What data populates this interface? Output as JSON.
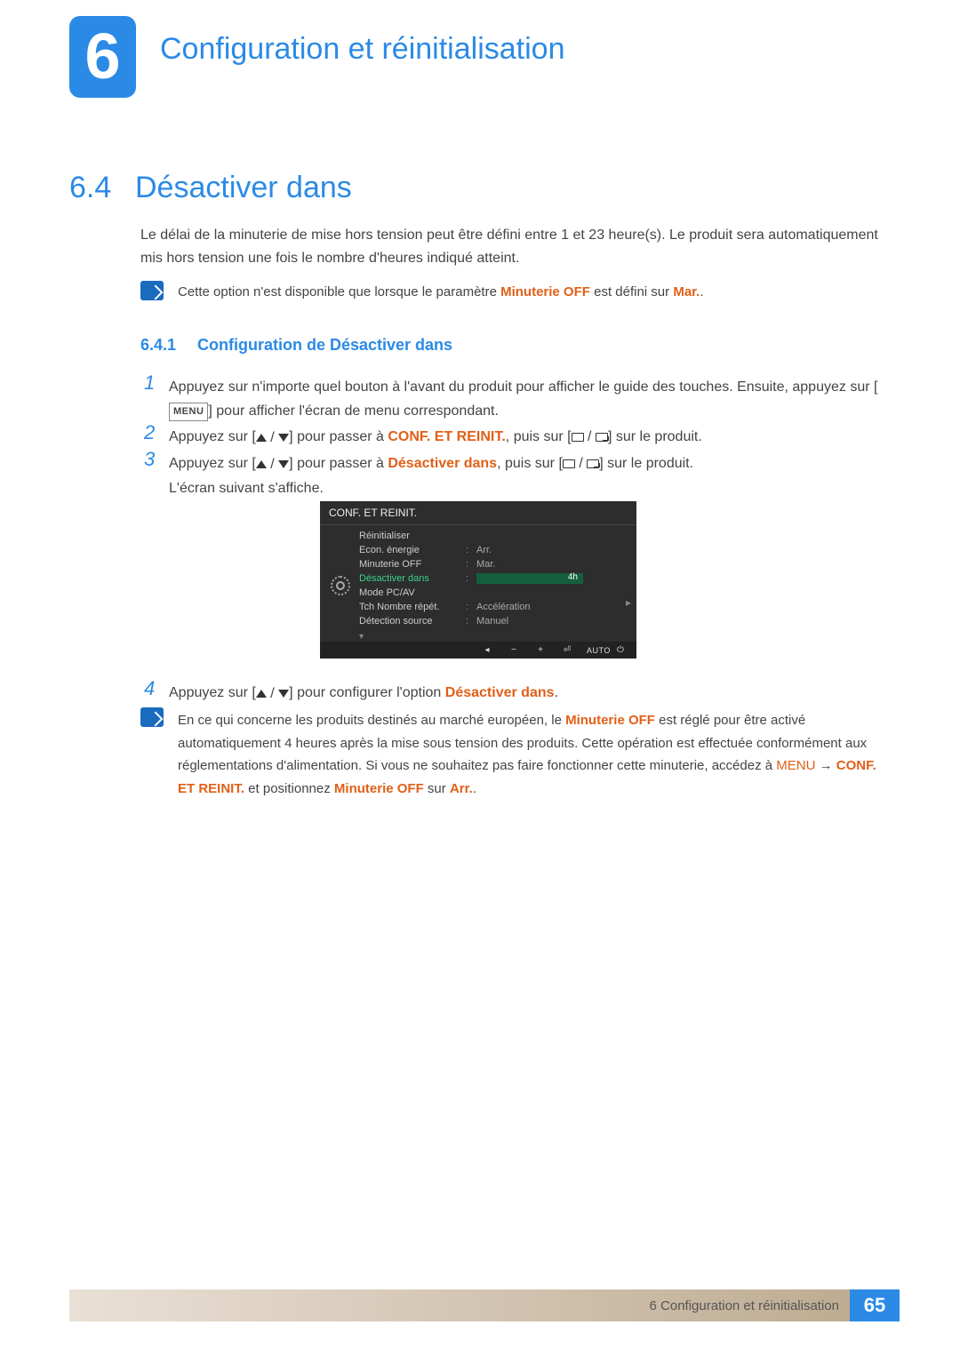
{
  "chapter": {
    "number": "6",
    "title": "Configuration et réinitialisation"
  },
  "section": {
    "number": "6.4",
    "title": "Désactiver dans"
  },
  "intro": "Le délai de la minuterie de mise hors tension peut être défini entre 1 et 23 heure(s). Le produit sera automatiquement mis hors tension une fois le nombre d'heures indiqué atteint.",
  "note1": {
    "pre": "Cette option n'est disponible que lorsque le paramètre ",
    "hl1": "Minuterie OFF",
    "mid": " est défini sur ",
    "hl2": "Mar.",
    "post": "."
  },
  "subsection": {
    "number": "6.4.1",
    "title": "Configuration de Désactiver dans"
  },
  "steps": {
    "s1": {
      "pre": "Appuyez sur n'importe quel bouton à l'avant du produit pour afficher le guide des touches. Ensuite, appuyez sur [",
      "menu": "MENU",
      "post": "] pour afficher l'écran de menu correspondant."
    },
    "s2": {
      "a": "Appuyez sur [",
      "b": "] pour passer à ",
      "hl": "CONF. ET REINIT.",
      "c": ", puis sur [",
      "d": "] sur le produit."
    },
    "s3": {
      "a": "Appuyez sur [",
      "b": "] pour passer à ",
      "hl": "Désactiver dans",
      "c": ", puis sur [",
      "d": "] sur le produit.",
      "e": "L'écran suivant s'affiche."
    },
    "s4": {
      "a": "Appuyez sur [",
      "b": "] pour configurer l'option ",
      "hl": "Désactiver dans",
      "c": "."
    }
  },
  "osd": {
    "title": "CONF. ET REINIT.",
    "rows": [
      {
        "label": "Réinitialiser",
        "value": ""
      },
      {
        "label": "Econ. énergie",
        "value": "Arr."
      },
      {
        "label": "Minuterie OFF",
        "value": "Mar."
      },
      {
        "label": "Désactiver dans",
        "value": "4h",
        "selected": true
      },
      {
        "label": "Mode PC/AV",
        "value": ""
      },
      {
        "label": "Tch Nombre répét.",
        "value": "Accélération"
      },
      {
        "label": "Détection source",
        "value": "Manuel"
      }
    ],
    "footer_auto": "AUTO"
  },
  "note2": {
    "a": "En ce qui concerne les produits destinés au marché européen, le ",
    "hl1": "Minuterie OFF",
    "b": " est réglé pour être activé automatiquement 4 heures après la mise sous tension des produits. Cette opération est effectuée conformément aux réglementations d'alimentation. Si vous ne souhaitez pas faire fonctionner cette minuterie, accédez à ",
    "menu": "MENU",
    "arrow": " → ",
    "hl2": "CONF. ET REINIT.",
    "c": " et positionnez ",
    "hl3": "Minuterie OFF",
    "d": " sur ",
    "hl4": "Arr.",
    "e": "."
  },
  "footer": {
    "text": "6 Configuration et réinitialisation",
    "page": "65"
  }
}
